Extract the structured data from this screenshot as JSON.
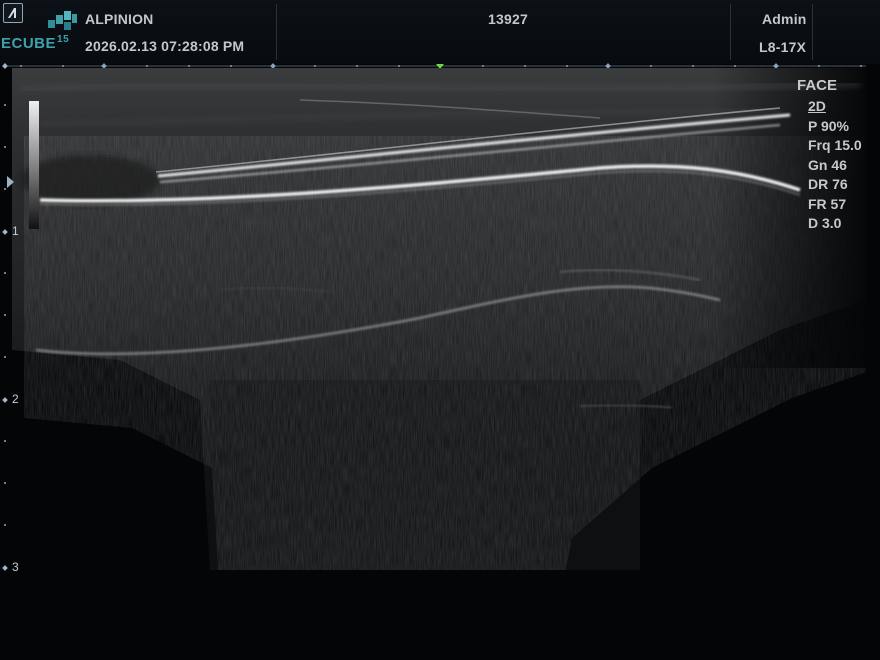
{
  "header": {
    "manufacturer": "ALPINION",
    "datetime": "2026.02.13   07:28:08 PM",
    "patient_id": "13927",
    "user": "Admin",
    "probe": "L8-17X",
    "brand": "ECUBE",
    "brand_model": "15"
  },
  "image": {
    "preset": "FACE",
    "mode": "2D",
    "params": [
      "P 90%",
      "Frq 15.0",
      "Gn 46",
      "DR 76",
      "FR 57",
      "D 3.0"
    ],
    "depth_labels": [
      "1",
      "2",
      "3"
    ],
    "depth_cm": 3.0
  },
  "colors": {
    "accent_logo": "#3fa2aa",
    "marker": "#9fb6cf",
    "focus_marker_green": "#6fdc3f"
  },
  "icons": {
    "corner": "alpinion-a-icon",
    "logo": "ecube-cube-logo",
    "focus": "focus-triangle-icon"
  }
}
